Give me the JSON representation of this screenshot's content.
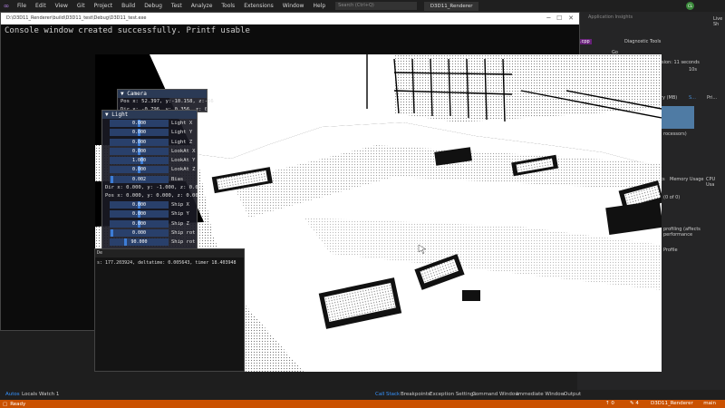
{
  "menu": {
    "items": [
      "File",
      "Edit",
      "View",
      "Git",
      "Project",
      "Build",
      "Debug",
      "Test",
      "Analyze",
      "Tools",
      "Extensions",
      "Window",
      "Help"
    ],
    "search_placeholder": "Search (Ctrl+Q)",
    "solution_name": "D3D11_Renderer",
    "avatar_initials": "CL"
  },
  "console": {
    "title": "D:\\D3D11_Renderer\\build\\D3D11_test\\Debug\\D3D11_test.exe",
    "output": "Console window created successfully. Printf usable"
  },
  "right_panel": {
    "app_insights": "Application Insights",
    "live_share": "Live Sh",
    "diag_title": "Diagnostic Tools",
    "file_tab": ".cpp",
    "go_label": "Go",
    "session": "sion: 11 seconds",
    "time_tick": "10s",
    "memory_label": "ry (MB)",
    "snapshot": "S...",
    "private": "Pri...",
    "processors": "rocessors)",
    "tabs": [
      "ts",
      "Memory Usage",
      "CPU Usa"
    ],
    "count": "(0 of 0)",
    "profiling": "profiling (affects performance",
    "profile": "Profile"
  },
  "camera": {
    "title": "Camera",
    "pos": "Pos x:  52.397, y:-10.158, z:-56",
    "dir": "Dir x: -0.796, y: 0.356, z: 0.4"
  },
  "light": {
    "title": "Light",
    "sliders": [
      {
        "value": "0.000",
        "label": "Light X",
        "fill": 0.5
      },
      {
        "value": "0.000",
        "label": "Light Y",
        "fill": 0.5
      },
      {
        "value": "0.000",
        "label": "Light Z",
        "fill": 0.5
      },
      {
        "value": "0.000",
        "label": "LookAt X",
        "fill": 0.5
      },
      {
        "value": "1.000",
        "label": "LookAt Y",
        "fill": 0.55
      },
      {
        "value": "0.000",
        "label": "LookAt Z",
        "fill": 0.5
      },
      {
        "value": "0.002",
        "label": "Bias",
        "fill": 0.02
      }
    ],
    "dir": "Dir x: 0.000, y: -1.000, z: 0.00",
    "pos": "Pos x: 0.000, y: 0.000, z: 0.00"
  },
  "ship": {
    "sliders": [
      {
        "value": "0.000",
        "label": "Ship X",
        "fill": 0.5
      },
      {
        "value": "0.000",
        "label": "Ship Y",
        "fill": 0.5
      },
      {
        "value": "0.000",
        "label": "Ship Z",
        "fill": 0.5
      },
      {
        "value": "0.000",
        "label": "Ship rot X",
        "fill": 0.02
      },
      {
        "value": "90.000",
        "label": "Ship rot Y",
        "fill": 0.25
      },
      {
        "value": "0.000",
        "label": "Ship rot Z",
        "fill": 0.02
      }
    ]
  },
  "debug": {
    "title": "De",
    "fps_line": "s: 177.203924, deltatime: 0.005643, timer 18.403948"
  },
  "bottom_tabs": {
    "left": [
      "Autos",
      "Locals",
      "Watch 1"
    ],
    "right": [
      "Call Stack",
      "Breakpoints",
      "Exception Settings",
      "Command Window",
      "Immediate Window",
      "Output"
    ]
  },
  "status": {
    "left": "Ready",
    "up": "0",
    "pencil": "4",
    "repo": "D3D11_Renderer",
    "branch": "main"
  },
  "colors": {
    "status_bar": "#ca5100",
    "imgui_header": "#2b3a55",
    "slider_bg": "#29406b",
    "slider_grab": "#3d7dd6"
  }
}
